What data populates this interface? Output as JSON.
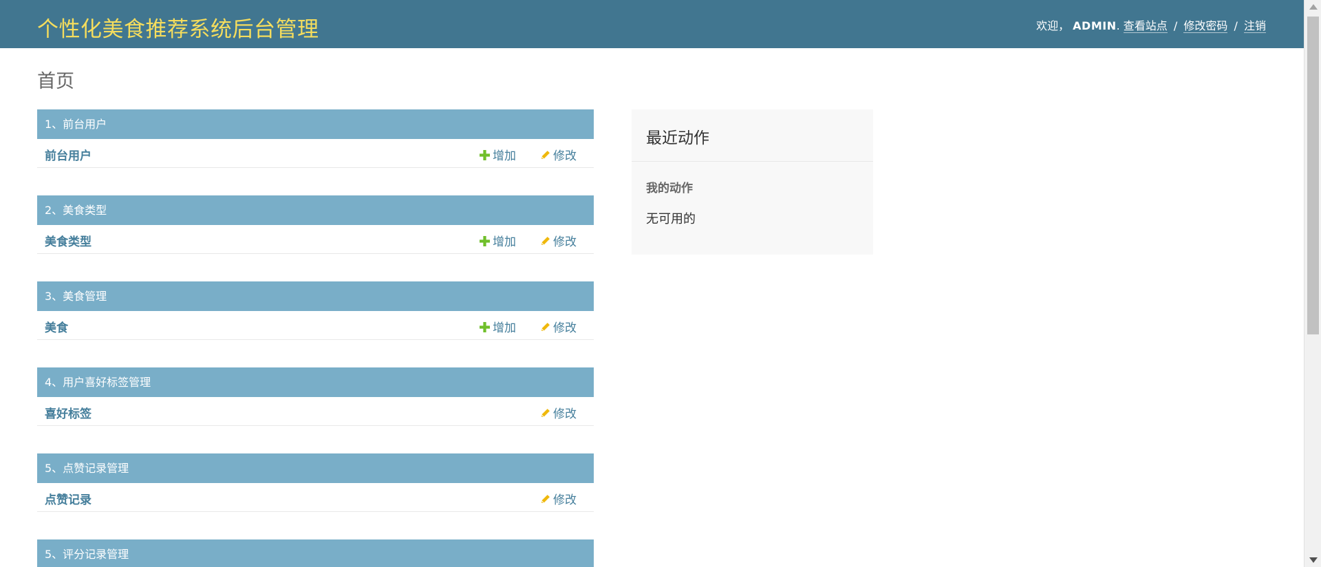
{
  "header": {
    "site_name": "个性化美食推荐系统后台管理",
    "welcome": "欢迎，",
    "username": "ADMIN",
    "after_username": ".",
    "view_site": "查看站点",
    "change_password": "修改密码",
    "logout": "注销",
    "separator": "/"
  },
  "page": {
    "title": "首页"
  },
  "modules": [
    {
      "caption": "1、前台用户",
      "row": {
        "name": "前台用户",
        "add": "增加",
        "change": "修改"
      }
    },
    {
      "caption": "2、美食类型",
      "row": {
        "name": "美食类型",
        "add": "增加",
        "change": "修改"
      }
    },
    {
      "caption": "3、美食管理",
      "row": {
        "name": "美食",
        "add": "增加",
        "change": "修改"
      }
    },
    {
      "caption": "4、用户喜好标签管理",
      "row": {
        "name": "喜好标签",
        "change": "修改"
      }
    },
    {
      "caption": "5、点赞记录管理",
      "row": {
        "name": "点赞记录",
        "change": "修改"
      }
    },
    {
      "caption": "5、评分记录管理"
    }
  ],
  "recent_actions": {
    "title": "最近动作",
    "my_actions": "我的动作",
    "empty": "无可用的"
  },
  "colors": {
    "header_bg": "#417690",
    "brand": "#f5dd5d",
    "caption_bg": "#79aec8",
    "link": "#447e9b",
    "add_icon": "#70bf2b",
    "change_icon": "#efb80b"
  },
  "icons": {
    "add": "plus-icon",
    "change": "pencil-icon"
  }
}
